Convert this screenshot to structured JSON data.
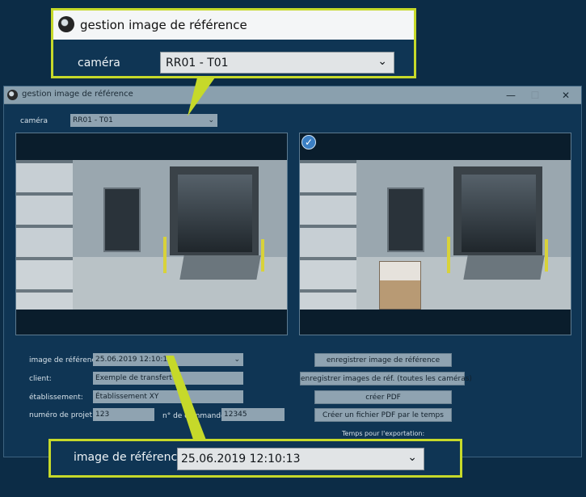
{
  "window": {
    "title": "gestion image de référence",
    "controls": {
      "minimize": "—",
      "maximize": "☐",
      "close": "✕"
    }
  },
  "camera": {
    "label": "caméra",
    "selected": "RR01 - T01"
  },
  "form": {
    "ref_image_label": "image de référence:",
    "ref_image_value": "25.06.2019 12:10:13",
    "client_label": "client:",
    "client_value": "Exemple de transfert",
    "establishment_label": "établissement:",
    "establishment_value": "Établissement XY",
    "project_label": "numéro de projet:",
    "project_value": "123",
    "order_label": "n° de commande:",
    "order_value": "12345"
  },
  "buttons": {
    "save_ref": "enregistrer image de référence",
    "save_all": "enregistrer images de réf. (toutes les caméras)",
    "create_pdf": "créer PDF",
    "create_pdf_time": "Créer un fichier PDF par le temps"
  },
  "export_time_label": "Temps pour l'exportation:",
  "callout_top": {
    "title": "gestion image de référence",
    "camera_label": "caméra",
    "camera_value": "RR01 - T01"
  },
  "callout_bottom": {
    "label": "image de référence",
    "value": "25.06.2019 12:10:13"
  },
  "icons": [
    "app-icon",
    "chevron-down-icon",
    "checkmark-icon"
  ],
  "colors": {
    "accent": "#c6d92a",
    "background": "#0f3554"
  }
}
